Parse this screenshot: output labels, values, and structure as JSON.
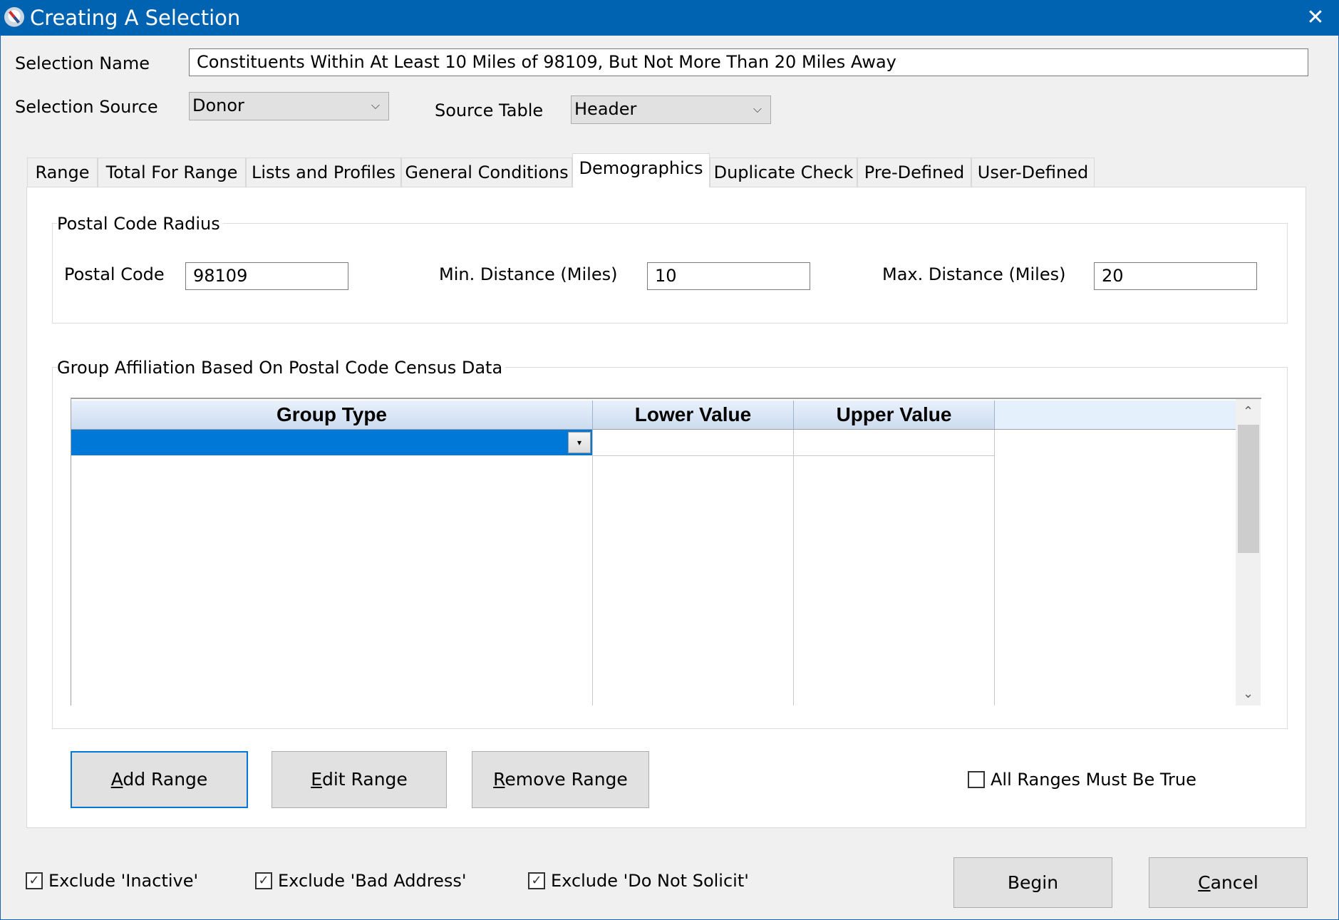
{
  "window": {
    "title": "Creating A Selection",
    "close_glyph": "✕"
  },
  "form": {
    "selection_name_label": "Selection Name",
    "selection_name_value": "Constituents Within At Least 10 Miles of 98109, But Not More Than 20 Miles Away",
    "selection_source_label": "Selection Source",
    "selection_source_value": "Donor",
    "source_table_label": "Source Table",
    "source_table_value": "Header",
    "chevron_glyph": "⌵"
  },
  "tabs": [
    {
      "label": "Range",
      "active": false
    },
    {
      "label": "Total For Range",
      "active": false
    },
    {
      "label": "Lists and Profiles",
      "active": false
    },
    {
      "label": "General Conditions",
      "active": false
    },
    {
      "label": "Demographics",
      "active": true
    },
    {
      "label": "Duplicate Check",
      "active": false
    },
    {
      "label": "Pre-Defined",
      "active": false
    },
    {
      "label": "User-Defined",
      "active": false
    }
  ],
  "postal_radius": {
    "group_title": "Postal Code Radius",
    "postal_code_label": "Postal Code",
    "postal_code_value": "98109",
    "min_distance_label": "Min. Distance (Miles)",
    "min_distance_value": "10",
    "max_distance_label": "Max. Distance (Miles)",
    "max_distance_value": "20"
  },
  "group_affiliation": {
    "group_title": "Group Affiliation Based On Postal Code Census Data",
    "columns": [
      "Group Type",
      "Lower Value",
      "Upper Value"
    ],
    "rows": [
      {
        "group_type": "",
        "lower_value": "",
        "upper_value": "",
        "selected": true
      }
    ],
    "dropdown_glyph": "▾",
    "scroll_up_glyph": "⌃",
    "scroll_down_glyph": "⌄"
  },
  "range_buttons": {
    "add": {
      "accel": "A",
      "rest": "dd Range"
    },
    "edit": {
      "accel": "E",
      "rest": "dit Range"
    },
    "remove": {
      "accel": "R",
      "rest": "emove Range"
    }
  },
  "all_ranges_must_be_true": {
    "label": "All Ranges Must Be True",
    "checked": false
  },
  "excludes": [
    {
      "label": "Exclude 'Inactive'",
      "checked": true
    },
    {
      "label": "Exclude 'Bad Address'",
      "checked": true
    },
    {
      "label": "Exclude 'Do Not Solicit'",
      "checked": true
    }
  ],
  "check_glyph": "✓",
  "footer": {
    "begin_label": "Begin",
    "cancel": {
      "accel": "C",
      "rest": "ancel"
    }
  }
}
